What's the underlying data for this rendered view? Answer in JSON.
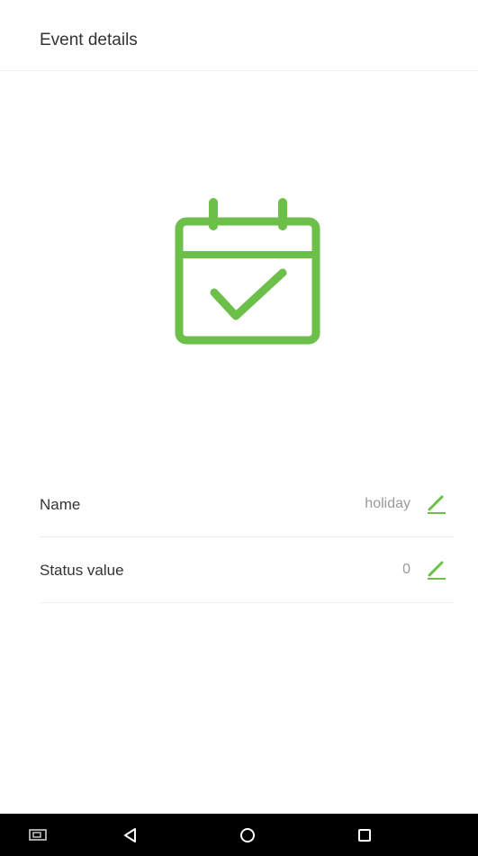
{
  "header": {
    "title": "Event details"
  },
  "hero": {
    "icon": "calendar-check-icon",
    "color": "#6cc04a"
  },
  "fields": [
    {
      "label": "Name",
      "value": "holiday",
      "edit_icon": "pencil-icon"
    },
    {
      "label": "Status value",
      "value": "0",
      "edit_icon": "pencil-icon"
    }
  ],
  "navbar": {
    "buttons": [
      "screenshot-icon",
      "back-icon",
      "home-icon",
      "recent-apps-icon"
    ]
  },
  "colors": {
    "accent": "#6cc04a",
    "navbar": "#000000",
    "text": "#333333",
    "muted": "#9a9a9a"
  }
}
